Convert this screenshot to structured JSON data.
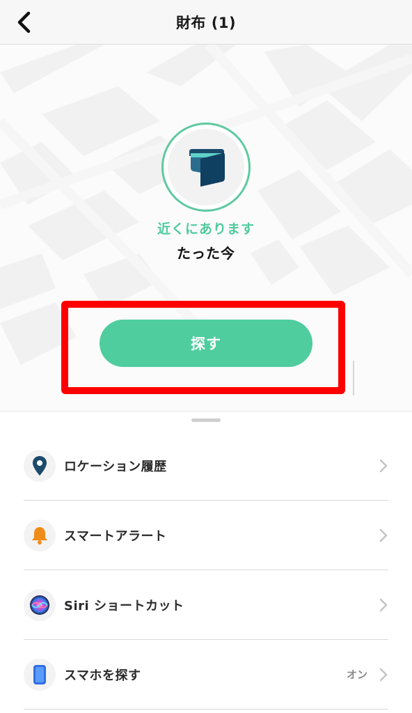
{
  "header": {
    "title": "財布 (1)",
    "back_icon": "chevron-left-icon"
  },
  "device": {
    "icon": "wallet-icon",
    "status": "近くにあります",
    "last_seen": "たった今",
    "ring_color": "#5ec9a0"
  },
  "find_button": {
    "label": "探す",
    "color": "#4fcd9e"
  },
  "highlight_color": "#ff0000",
  "menu": {
    "items": [
      {
        "label": "ロケーション履歴",
        "icon": "location-pin-icon",
        "value": ""
      },
      {
        "label": "スマートアラート",
        "icon": "bell-icon",
        "value": ""
      },
      {
        "label": "Siri ショートカット",
        "icon": "siri-icon",
        "value": ""
      },
      {
        "label": "スマホを探す",
        "icon": "phone-icon",
        "value": "オン"
      }
    ]
  }
}
